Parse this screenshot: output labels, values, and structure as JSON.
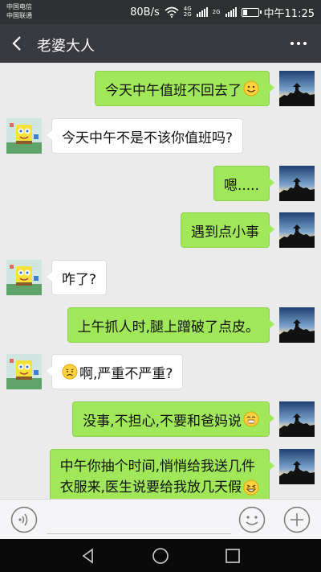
{
  "status_bar": {
    "carrier1": "中国电信",
    "carrier2": "中国联通",
    "speed": "80B/s",
    "network_top": "4G",
    "network_bottom": "2G",
    "network_extra": "2G",
    "time": "中午11:25",
    "battery_level": 0.3
  },
  "header": {
    "title": "老婆大人"
  },
  "messages": [
    {
      "side": "right",
      "text": "今天中午值班不回去了",
      "emoji": "smile-emoji"
    },
    {
      "side": "left",
      "text": "今天中午不是不该你值班吗?"
    },
    {
      "side": "right",
      "text": "嗯....."
    },
    {
      "side": "right",
      "text": "遇到点小事"
    },
    {
      "side": "left",
      "text": "咋了?"
    },
    {
      "side": "right",
      "text": "上午抓人时,腿上蹭破了点皮。"
    },
    {
      "side": "left",
      "text": "啊,严重不严重?",
      "emoji": "worried-emoji"
    },
    {
      "side": "right",
      "text": "没事,不担心,不要和爸妈说",
      "emoji": "shush-emoji"
    },
    {
      "side": "right",
      "line1": "中午你抽个时间,悄悄给我送几件",
      "line2": "衣服来,医生说要给我放几天假",
      "emoji": "grin-emoji"
    }
  ],
  "colors": {
    "sent_bubble": "#a0e75a",
    "received_bubble": "#ffffff",
    "header": "#393a3f",
    "chat_bg": "#ebebeb"
  }
}
